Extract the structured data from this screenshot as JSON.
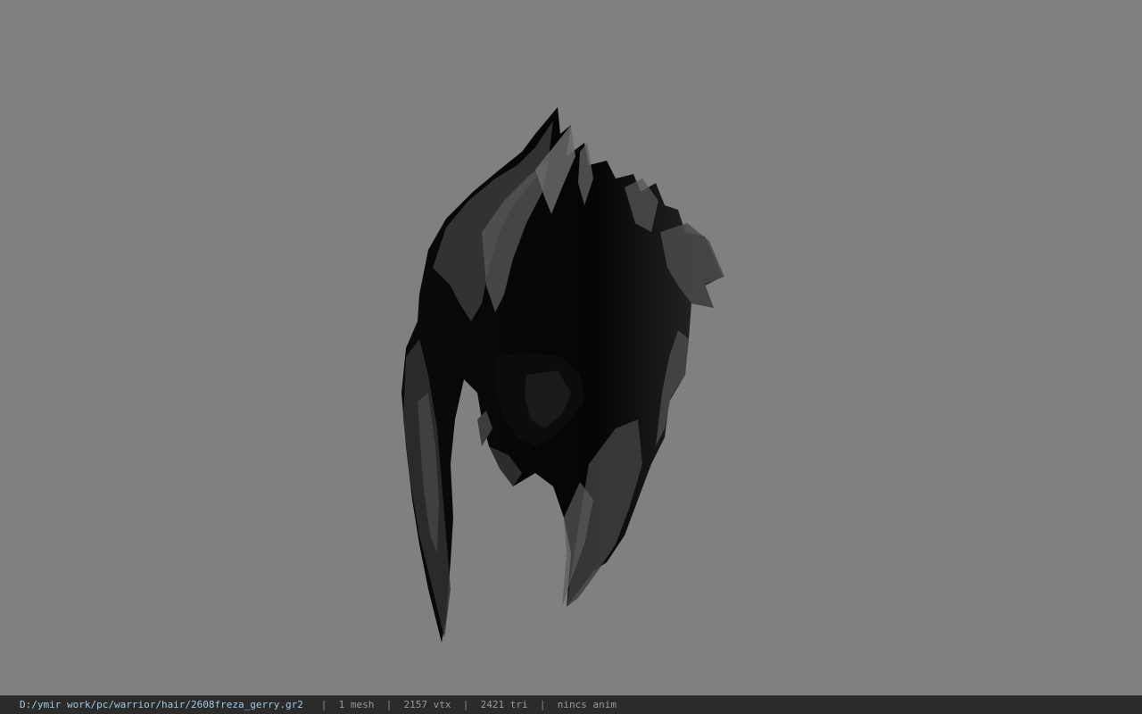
{
  "viewer": {
    "background_color": "#808080",
    "model_color": "#000000"
  },
  "status_bar": {
    "file_path": "D:/ymir work/pc/warrior/hair/2608freza_gerry.gr2",
    "separator": "|",
    "mesh_count": "1 mesh",
    "vertex_count": "2157 vtx",
    "triangle_count": "2421 tri",
    "animation": "nincs anim"
  }
}
